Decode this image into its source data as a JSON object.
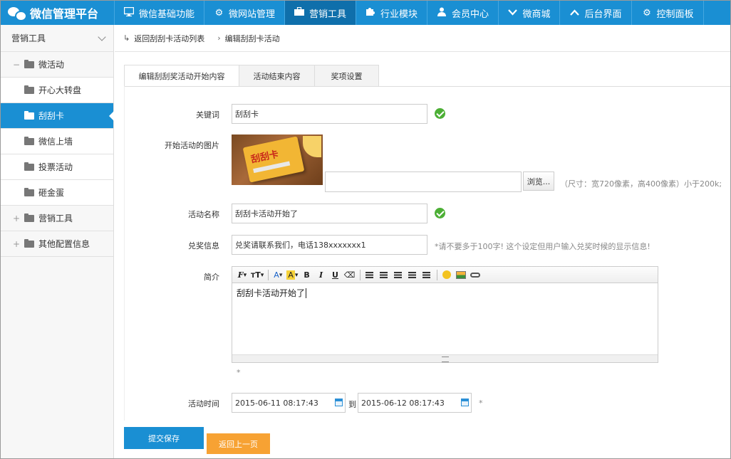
{
  "app": {
    "title": "微信管理平台"
  },
  "nav": [
    {
      "label": "微信基础功能",
      "icon": "monitor-icon"
    },
    {
      "label": "微网站管理",
      "icon": "gear-icon"
    },
    {
      "label": "营销工具",
      "icon": "briefcase-icon",
      "active": true
    },
    {
      "label": "行业模块",
      "icon": "puzzle-icon"
    },
    {
      "label": "会员中心",
      "icon": "user-icon"
    },
    {
      "label": "微商城",
      "icon": "chevron-down-icon"
    },
    {
      "label": "后台界面",
      "icon": "chevron-up-icon"
    },
    {
      "label": "控制面板",
      "icon": "gear-icon"
    }
  ],
  "sidebar": {
    "header": "营销工具",
    "items": [
      {
        "label": "微活动",
        "toggle": "−"
      },
      {
        "label": "开心大转盘"
      },
      {
        "label": "刮刮卡",
        "active": true
      },
      {
        "label": "微信上墙"
      },
      {
        "label": "投票活动"
      },
      {
        "label": "砸金蛋"
      },
      {
        "label": "营销工具",
        "toggle": "+"
      },
      {
        "label": "其他配置信息",
        "toggle": "+"
      }
    ]
  },
  "breadcrumb": {
    "back_label": "返回刮刮卡活动列表",
    "current": "编辑刮刮卡活动"
  },
  "tabs": [
    {
      "label": "编辑刮刮奖活动开始内容",
      "active": true
    },
    {
      "label": "活动结束内容"
    },
    {
      "label": "奖项设置"
    }
  ],
  "form": {
    "keyword": {
      "label": "关键词",
      "value": "刮刮卡"
    },
    "image": {
      "label": "开始活动的图片",
      "browse_label": "浏览...",
      "hint": "（尺寸：宽720像素，高400像素）小于200k;",
      "card_text": "刮刮卡"
    },
    "name": {
      "label": "活动名称",
      "value": "刮刮卡活动开始了"
    },
    "redeem": {
      "label": "兑奖信息",
      "value": "兑奖请联系我们，电话138xxxxxxx1",
      "hint": "*请不要多于100字! 这个设定但用户输入兑奖时候的显示信息!"
    },
    "intro": {
      "label": "简介",
      "content": "刮刮卡活动开始了",
      "required_mark": "*",
      "toolbar": [
        "font-family",
        "font-size",
        "font-color",
        "highlight",
        "bold",
        "italic",
        "underline",
        "clear-format",
        "align-left",
        "align-center",
        "align-right",
        "ordered-list",
        "unordered-list",
        "emoticon",
        "image",
        "link"
      ]
    },
    "time": {
      "label": "活动时间",
      "start": "2015-06-11 08:17:43",
      "end": "2015-06-12 08:17:43",
      "separator": "到",
      "required_mark": "*"
    }
  },
  "buttons": {
    "submit": "提交保存",
    "back": "返回上一页"
  },
  "colors": {
    "primary": "#1a8fd3",
    "active_nav": "#0f6fab",
    "ok": "#4caf35",
    "back_button": "#f7a233"
  }
}
